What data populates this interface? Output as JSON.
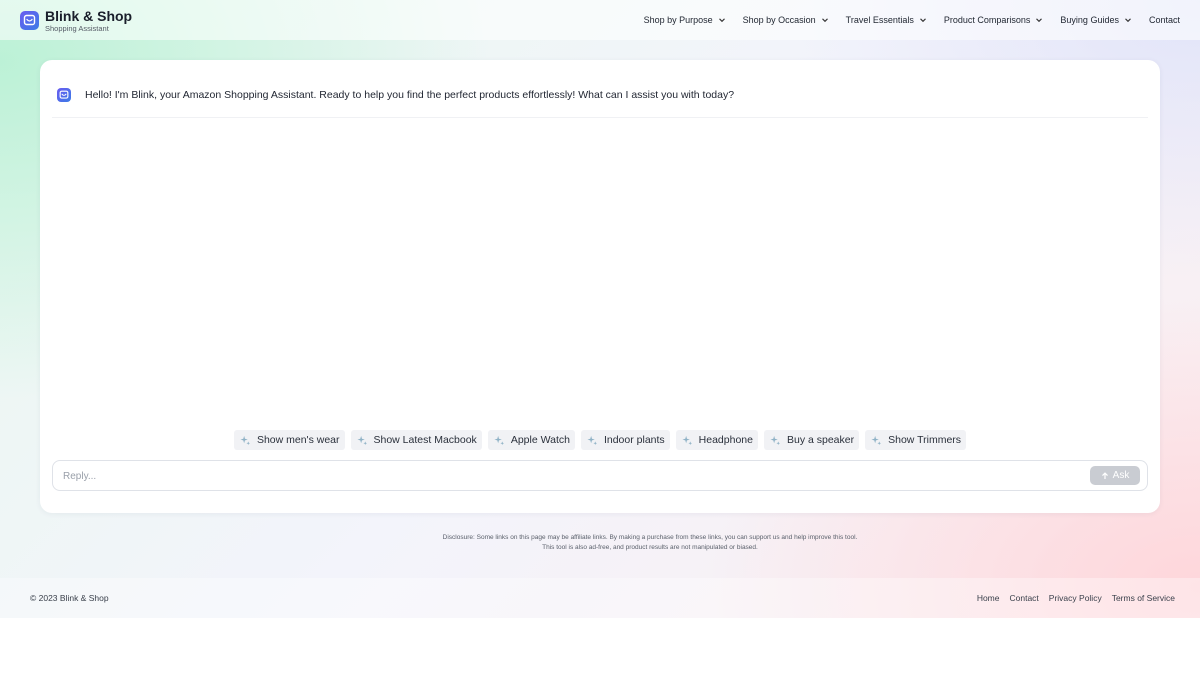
{
  "brand": {
    "name": "Blink & Shop",
    "subtitle": "Shopping Assistant",
    "logo_icon": "chat-cart-icon",
    "accent": "#5b6ef0"
  },
  "nav": {
    "items": [
      {
        "label": "Shop by Purpose",
        "has_dropdown": true
      },
      {
        "label": "Shop by Occasion",
        "has_dropdown": true
      },
      {
        "label": "Travel Essentials",
        "has_dropdown": true
      },
      {
        "label": "Product Comparisons",
        "has_dropdown": true
      },
      {
        "label": "Buying Guides",
        "has_dropdown": true
      },
      {
        "label": "Contact",
        "has_dropdown": false
      }
    ]
  },
  "chat": {
    "greeting": "Hello! I'm Blink, your Amazon Shopping Assistant. Ready to help you find the perfect products effortlessly! What can I assist you with today?",
    "suggestions": [
      "Show men's wear",
      "Show Latest Macbook",
      "Apple Watch",
      "Indoor plants",
      "Headphone",
      "Buy a speaker",
      "Show Trimmers"
    ],
    "suggestion_icon": "sparkle-icon",
    "input_placeholder": "Reply...",
    "input_value": "",
    "ask_label": "Ask",
    "ask_icon": "arrow-up-icon"
  },
  "disclosure": {
    "line1": "Disclosure: Some links on this page may be affiliate links. By making a purchase from these links, you can support us and help improve this tool.",
    "line2": "This tool is also ad-free, and product results are not manipulated or biased."
  },
  "footer": {
    "copyright": "© 2023 Blink & Shop",
    "links": [
      "Home",
      "Contact",
      "Privacy Policy",
      "Terms of Service"
    ]
  }
}
